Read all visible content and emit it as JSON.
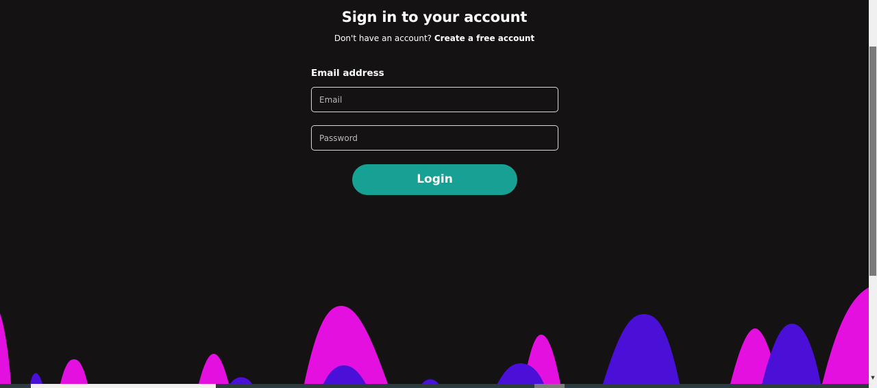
{
  "header": {
    "title": "Sign in to your account",
    "subtitle_prefix": "Don't have an account?",
    "create_account_link": "Create a free account"
  },
  "form": {
    "email_label": "Email address",
    "email_placeholder": "Email",
    "email_value": "",
    "password_placeholder": "Password",
    "password_value": "",
    "login_label": "Login"
  },
  "colors": {
    "background": "#151213",
    "accent": "#17a094",
    "wave_magenta": "#e410df",
    "wave_violet": "#4a10d8"
  }
}
